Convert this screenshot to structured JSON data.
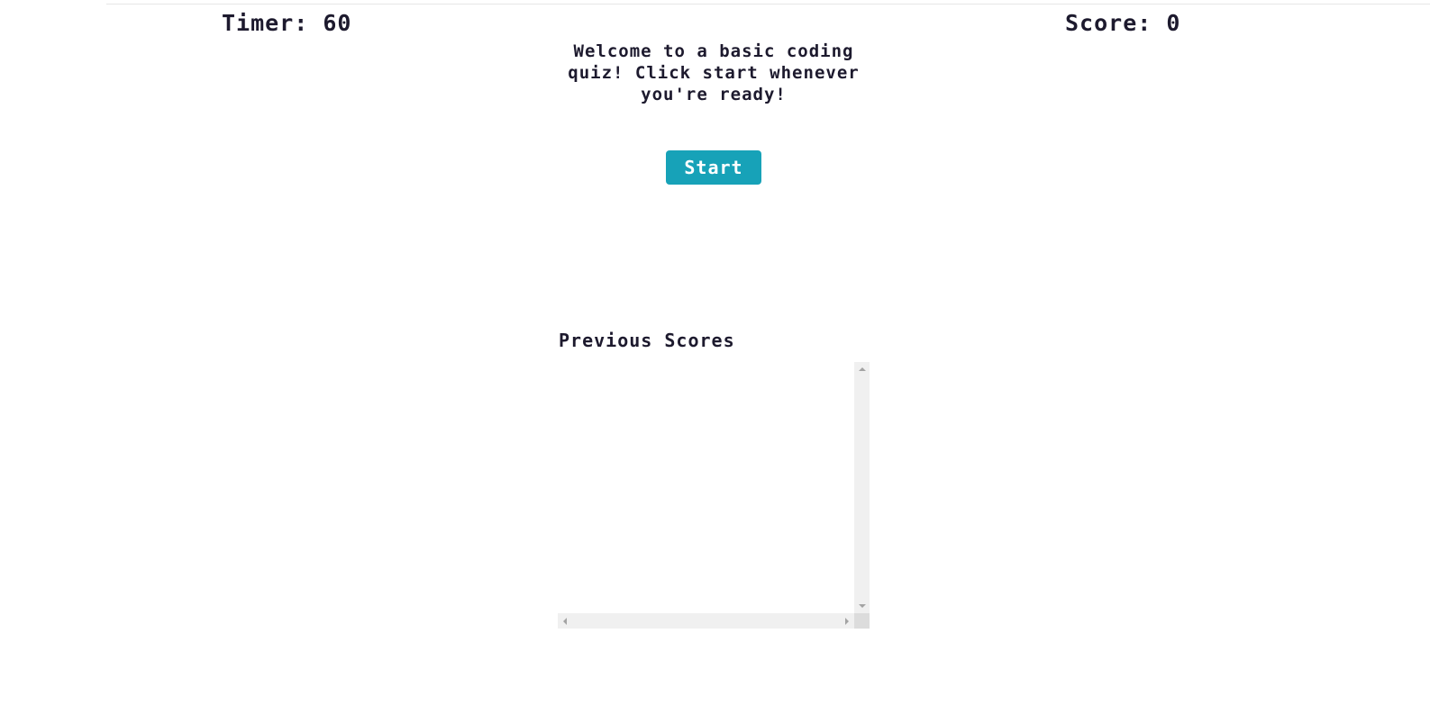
{
  "header": {
    "timer_label": "Timer: 60",
    "score_label": "Score: 0"
  },
  "intro": {
    "message": "Welcome to a basic coding quiz! Click start whenever you're ready!",
    "start_label": "Start"
  },
  "previous_scores": {
    "title": "Previous Scores",
    "entries": []
  },
  "colors": {
    "accent": "#17a2b8",
    "text": "#1d1a2e",
    "background": "#ffffff"
  }
}
